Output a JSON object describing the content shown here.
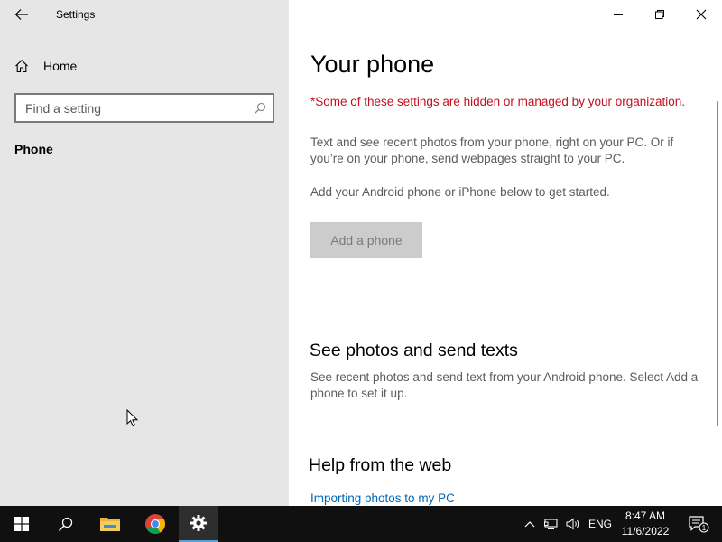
{
  "window": {
    "title": "Settings"
  },
  "nav": {
    "home_label": "Home",
    "search_placeholder": "Find a setting",
    "selected_item": "Phone"
  },
  "main": {
    "title": "Your phone",
    "org_warning": "*Some of these settings are hidden or managed by your organization.",
    "description": "Text and see recent photos from your phone, right on your PC. Or if you’re on your phone, send webpages straight to your PC.",
    "description2": "Add your Android phone or iPhone below to get started.",
    "add_phone_label": "Add a phone",
    "section_photos": {
      "heading": "See photos and send texts",
      "text": "See recent photos and send text from your Android phone. Select Add a phone to set it up."
    },
    "section_help": {
      "heading": "Help from the web",
      "link": "Importing photos to my PC"
    }
  },
  "taskbar": {
    "language": "ENG",
    "time": "8:47 AM",
    "date": "11/6/2022",
    "notification_count": "1",
    "accent_color": "#4fa3e3"
  },
  "icons": [
    "back-arrow-icon",
    "home-icon",
    "search-icon",
    "minimize-icon",
    "maximize-icon",
    "close-icon",
    "windows-start-icon",
    "folder-icon",
    "chrome-icon",
    "gear-icon",
    "chevron-up-icon",
    "network-icon",
    "volume-icon",
    "notification-icon"
  ],
  "colors": {
    "warning": "#c50f1f",
    "link": "#0067b8",
    "nav_background": "#e6e6e6"
  }
}
